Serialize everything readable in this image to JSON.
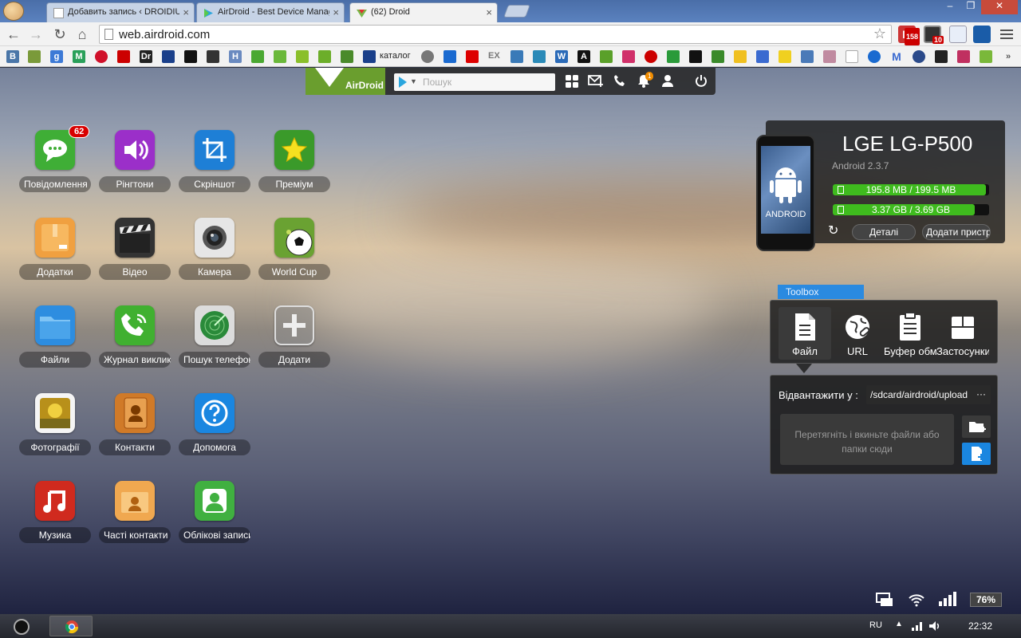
{
  "tabs": [
    {
      "title": "Добавить запись ‹ DROIDIUM",
      "active": false
    },
    {
      "title": "AirDroid - Best Device Manager",
      "active": false
    },
    {
      "title": "(62) Droid",
      "active": true
    }
  ],
  "omnibox": {
    "url": "web.airdroid.com"
  },
  "extensions": {
    "gmail_count": "158",
    "ext2_count": "10"
  },
  "bookmarks": {
    "catalog_label": "каталог",
    "ex_label": "EX"
  },
  "airdroid": {
    "logo_text": "AirDroid",
    "search_placeholder": "Пошук",
    "notification_count": "1"
  },
  "apps": [
    {
      "label": "Повідомлення",
      "badge": "62",
      "icon": "messages-icon",
      "color": "#3fae36"
    },
    {
      "label": "Рінгтони",
      "icon": "speaker-icon",
      "color": "#9b2fc9"
    },
    {
      "label": "Скріншот",
      "icon": "crop-icon",
      "color": "#1e7fd6"
    },
    {
      "label": "Преміум",
      "icon": "star-icon",
      "color": "#3a9a2a"
    },
    {
      "label": "Додатки",
      "icon": "package-icon",
      "color": "#f0a040"
    },
    {
      "label": "Відео",
      "icon": "clapperboard-icon",
      "color": "#333333"
    },
    {
      "label": "Камера",
      "icon": "camera-icon",
      "color": "#e6e6e6"
    },
    {
      "label": "World Cup",
      "icon": "soccer-ball-icon",
      "color": "#6aa232"
    },
    {
      "label": "Файли",
      "icon": "folder-icon",
      "color": "#2d8de0"
    },
    {
      "label": "Журнал викликів",
      "icon": "phone-call-icon",
      "color": "#40b030"
    },
    {
      "label": "Пошук телефону",
      "icon": "radar-icon",
      "color": "#dcdcdc"
    },
    {
      "label": "Додати",
      "icon": "plus-icon",
      "color": "#8a8a8a"
    },
    {
      "label": "Фотографії",
      "icon": "photo-icon",
      "color": "#f5f5f5"
    },
    {
      "label": "Контакти",
      "icon": "contact-book-icon",
      "color": "#d07a28"
    },
    {
      "label": "Допомога",
      "icon": "question-icon",
      "color": "#1a86e0"
    },
    {
      "label": "Музика",
      "icon": "music-note-icon",
      "color": "#d02a1e"
    },
    {
      "label": "Часті контакти",
      "icon": "contact-card-icon",
      "color": "#f0a850"
    },
    {
      "label": "Облікові записи",
      "icon": "user-account-icon",
      "color": "#40b040"
    }
  ],
  "device": {
    "model": "LGE LG-P500",
    "os": "Android 2.3.7",
    "phone_screen_label": "ANDROID",
    "ram": {
      "text": "195.8 MB / 199.5 MB",
      "used_fraction": 0.98
    },
    "storage": {
      "text": "3.37 GB / 3.69 GB",
      "used_fraction": 0.91
    },
    "details_label": "Деталі",
    "add_label": "Додати пристрій"
  },
  "toolbox": {
    "tab_label": "Toolbox",
    "tools": [
      {
        "label": "Файл",
        "icon": "file-icon",
        "active": true
      },
      {
        "label": "URL",
        "icon": "globe-link-icon",
        "active": false
      },
      {
        "label": "Буфер обміну",
        "icon": "clipboard-icon",
        "active": false
      },
      {
        "label": "Застосунки",
        "icon": "apk-box-icon",
        "active": false
      }
    ],
    "upload_label": "Відвантажити у :",
    "upload_path": "/sdcard/airdroid/upload",
    "more_label": "···",
    "drop_text": "Перетягніть і вкиньте файли або папки сюди"
  },
  "status": {
    "battery": "76%"
  },
  "taskbar": {
    "lang": "RU",
    "time": "22:32"
  }
}
